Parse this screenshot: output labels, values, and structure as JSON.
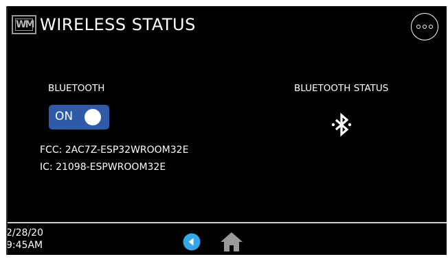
{
  "header": {
    "logo_text": "WM",
    "title": "WIRELESS STATUS"
  },
  "bluetooth": {
    "label": "BLUETOOTH",
    "toggle_state": "ON",
    "status_label": "BLUETOOTH STATUS",
    "fcc_id": "FCC: 2AC7Z-ESP32WROOM32E",
    "ic_id": "IC: 21098-ESPWROOM32E"
  },
  "footer": {
    "date": "2/28/20",
    "time": "9:45AM"
  },
  "colors": {
    "background": "#000000",
    "toggle_on": "#2e5aa8",
    "back_button": "#35a6e8",
    "home_icon": "#9a9a9a"
  },
  "icons": {
    "menu": "more-options-icon",
    "bluetooth": "bluetooth-icon",
    "back": "back-arrow-icon",
    "home": "home-icon"
  }
}
